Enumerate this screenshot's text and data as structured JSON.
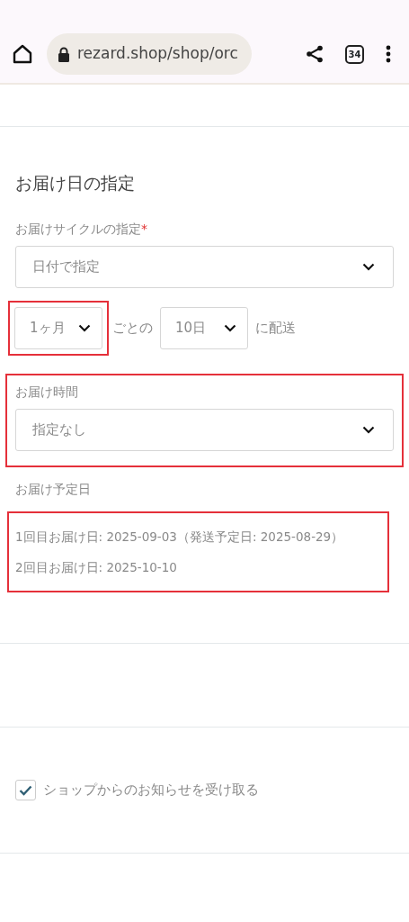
{
  "browser": {
    "url": "rezard.shop/shop/orc",
    "tab_count": "34"
  },
  "delivery": {
    "title": "お届け日の指定",
    "cycle": {
      "label": "お届けサイクルの指定",
      "required_mark": "*",
      "value": "日付で指定"
    },
    "interval": {
      "value": "1ヶ月",
      "highlighted": true
    },
    "interval_text": "ごとの",
    "day": {
      "value": "10日"
    },
    "day_text": "に配送",
    "time": {
      "label": "お届け時間",
      "value": "指定なし",
      "highlighted": true
    },
    "schedule": {
      "label": "お届け予定日",
      "highlighted": true,
      "lines": [
        "1回目お届け日: 2025-09-03（発送予定日: 2025-08-29）",
        "2回目お届け日: 2025-10-10"
      ]
    }
  },
  "newsletter": {
    "label": "ショップからのお知らせを受け取る",
    "checked": true
  }
}
